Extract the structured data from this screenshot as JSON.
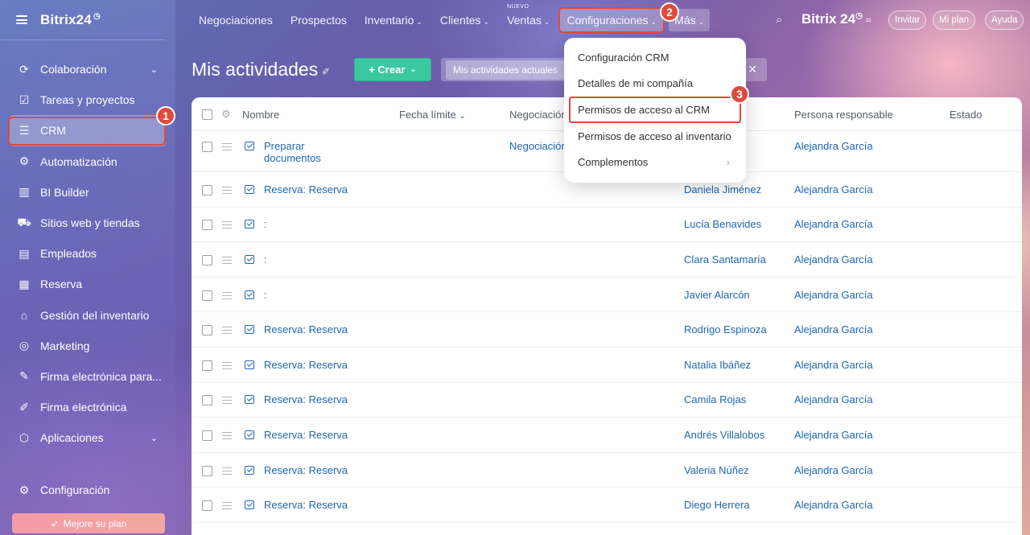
{
  "sidebar": {
    "logo": "Bitrix24",
    "logo_mark": "◷",
    "items": [
      {
        "label": "Colaboración",
        "icon": "collaboration-icon",
        "glyph": "⟳",
        "chevron": true
      },
      {
        "label": "Tareas y proyectos",
        "icon": "tasks-icon",
        "glyph": "☑"
      },
      {
        "label": "CRM",
        "icon": "crm-funnel-icon",
        "glyph": "☰",
        "active": true
      },
      {
        "label": "Automatización",
        "icon": "automation-icon",
        "glyph": "⚙"
      },
      {
        "label": "BI Builder",
        "icon": "bi-chart-icon",
        "glyph": "▥"
      },
      {
        "label": "Sitios web y tiendas",
        "icon": "cart-icon",
        "glyph": "⛟"
      },
      {
        "label": "Empleados",
        "icon": "employees-icon",
        "glyph": "▤"
      },
      {
        "label": "Reserva",
        "icon": "calendar-icon",
        "glyph": "▦"
      },
      {
        "label": "Gestión del inventario",
        "icon": "inventory-icon",
        "glyph": "⌂"
      },
      {
        "label": "Marketing",
        "icon": "target-icon",
        "glyph": "◎"
      },
      {
        "label": "Firma electrónica para...",
        "icon": "signature-doc-icon",
        "glyph": "✎"
      },
      {
        "label": "Firma electrónica",
        "icon": "pen-icon",
        "glyph": "✐"
      },
      {
        "label": "Aplicaciones",
        "icon": "apps-cube-icon",
        "glyph": "⬡",
        "chevron": true
      }
    ],
    "config_label": "Configuración",
    "upgrade_label": "Mejore su plan"
  },
  "topnav": {
    "items": [
      {
        "label": "Negociaciones",
        "caret": false
      },
      {
        "label": "Prospectos",
        "caret": false
      },
      {
        "label": "Inventario",
        "caret": true
      },
      {
        "label": "Clientes",
        "caret": true
      },
      {
        "label": "Ventas",
        "caret": true,
        "badge": "NUEVO"
      },
      {
        "label": "Configuraciones",
        "caret": true,
        "selected": true
      },
      {
        "label": "Más",
        "caret": true
      }
    ],
    "brand": "Bitrix 24",
    "invite": "Invitar",
    "my_plan": "Mi plan",
    "help": "Ayuda"
  },
  "page": {
    "title": "Mis actividades",
    "create_label": "+ Crear",
    "filter_chip": "Mis actividades actuales"
  },
  "table": {
    "columns": [
      "Nombre",
      "Fecha límite",
      "Negociación",
      "Persona responsable",
      "Estado"
    ],
    "rows": [
      {
        "name": "Preparar documentos",
        "deal": "Negociación",
        "contact": "",
        "responsible": "Alejandra García"
      },
      {
        "name": "Reserva: Reserva",
        "deal": "",
        "contact": "Daniela Jiménez",
        "responsible": "Alejandra García"
      },
      {
        "name": ":",
        "deal": "",
        "contact": "Lucía Benavides",
        "responsible": "Alejandra García"
      },
      {
        "name": ":",
        "deal": "",
        "contact": "Clara Santamaría",
        "responsible": "Alejandra García"
      },
      {
        "name": ":",
        "deal": "",
        "contact": "Javier Alarcón",
        "responsible": "Alejandra García"
      },
      {
        "name": "Reserva: Reserva",
        "deal": "",
        "contact": "Rodrigo Espinoza",
        "responsible": "Alejandra García"
      },
      {
        "name": "Reserva: Reserva",
        "deal": "",
        "contact": "Natalia Ibáñez",
        "responsible": "Alejandra García"
      },
      {
        "name": "Reserva: Reserva",
        "deal": "",
        "contact": "Camila Rojas",
        "responsible": "Alejandra García"
      },
      {
        "name": "Reserva: Reserva",
        "deal": "",
        "contact": "Andrés Villalobos",
        "responsible": "Alejandra García"
      },
      {
        "name": "Reserva: Reserva",
        "deal": "",
        "contact": "Valeria Núñez",
        "responsible": "Alejandra García"
      },
      {
        "name": "Reserva: Reserva",
        "deal": "",
        "contact": "Diego Herrera",
        "responsible": "Alejandra García"
      }
    ]
  },
  "dropdown": {
    "items": [
      {
        "label": "Configuración CRM"
      },
      {
        "label": "Detalles de mi compañía"
      },
      {
        "label": "Permisos de acceso al CRM",
        "highlighted": true
      },
      {
        "label": "Permisos de acceso al inventario"
      },
      {
        "label": "Complementos",
        "submenu": true
      }
    ]
  },
  "steps": [
    "1",
    "2",
    "3"
  ],
  "colors": {
    "accent_green": "#3bc8a0",
    "link": "#2067b0",
    "highlight_red": "#e04a3c"
  }
}
